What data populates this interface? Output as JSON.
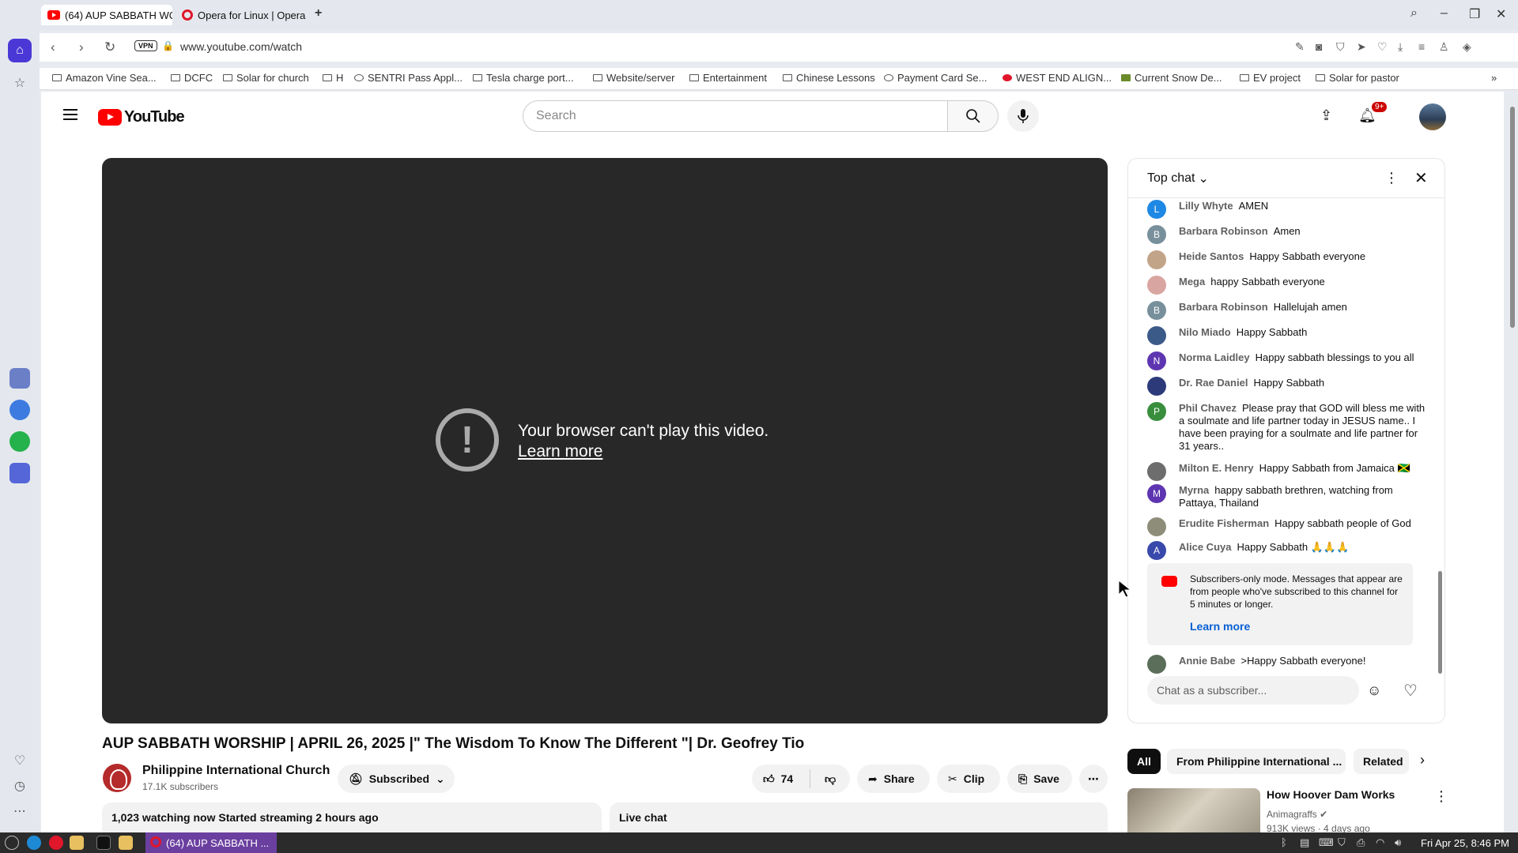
{
  "browser": {
    "tabs": [
      {
        "label": "(64) AUP SABBATH WO",
        "active": true
      },
      {
        "label": "Opera for Linux | Opera",
        "active": false
      }
    ],
    "url": "www.youtube.com/watch",
    "vpn_label": "VPN",
    "bookmarks": [
      "Amazon Vine Sea...",
      "DCFC",
      "Solar for church",
      "H",
      "SENTRI Pass Appl...",
      "Tesla charge port...",
      "Website/server",
      "Entertainment",
      "Chinese Lessons",
      "Payment Card Se...",
      "WEST END ALIGN...",
      "Current Snow De...",
      "EV project",
      "Solar for pastor"
    ]
  },
  "youtube": {
    "logo_text": "YouTube",
    "search_placeholder": "Search",
    "notification_badge": "9+",
    "player": {
      "error_title": "Your browser can't play this video.",
      "error_link": "Learn more"
    },
    "video": {
      "title": "AUP SABBATH WORSHIP | APRIL 26, 2025 |\" The Wisdom To Know The Different \"| Dr. Geofrey Tio",
      "channel": "Philippine International Church",
      "subscribers": "17.1K subscribers",
      "subscribed_label": "Subscribed",
      "likes": "74",
      "share_label": "Share",
      "clip_label": "Clip",
      "save_label": "Save",
      "watching": "1,023 watching now  Started streaming 2 hours ago",
      "live_chat_label": "Live chat"
    },
    "chat": {
      "header": "Top chat",
      "messages": [
        {
          "author": "Lilly Whyte",
          "text": "AMEN",
          "initial": "L",
          "color": "#1e88e5"
        },
        {
          "author": "Barbara Robinson",
          "text": "Amen",
          "initial": "B",
          "color": "#78909c"
        },
        {
          "author": "Heide Santos",
          "text": "Happy Sabbath everyone",
          "initial": "",
          "color": "#c2a488"
        },
        {
          "author": "Mega",
          "text": "happy Sabbath everyone",
          "initial": "",
          "color": "#d9a5a0"
        },
        {
          "author": "Barbara Robinson",
          "text": "Hallelujah amen",
          "initial": "B",
          "color": "#78909c"
        },
        {
          "author": "Nilo Miado",
          "text": "Happy Sabbath",
          "initial": "",
          "color": "#3c5a88"
        },
        {
          "author": "Norma Laidley",
          "text": "Happy sabbath blessings to you all",
          "initial": "N",
          "color": "#5e35b1"
        },
        {
          "author": "Dr. Rae Daniel",
          "text": "Happy Sabbath",
          "initial": "",
          "color": "#2d3a7a"
        },
        {
          "author": "Phil Chavez",
          "text": "Please pray that GOD will bless me with a soulmate and life partner today in JESUS name.. I have been praying for a soulmate and life partner for 31 years..",
          "initial": "P",
          "color": "#388e3c"
        },
        {
          "author": "Milton E. Henry",
          "text": "Happy Sabbath from Jamaica 🇯🇲",
          "initial": "",
          "color": "#6d6d6d"
        },
        {
          "author": "Myrna",
          "text": "happy sabbath brethren, watching from Pattaya, Thailand",
          "initial": "M",
          "color": "#5e35b1"
        },
        {
          "author": "Erudite Fisherman",
          "text": "Happy sabbath people of God",
          "initial": "",
          "color": "#8d8d7a"
        },
        {
          "author": "Alice Cuya",
          "text": "Happy Sabbath 🙏🙏🙏",
          "initial": "A",
          "color": "#3949ab"
        },
        {
          "author": "Annie Babe",
          "text": ">Happy Sabbath everyone!",
          "initial": "",
          "color": "#5a6e5a"
        }
      ],
      "subscriber_notice": "Subscribers-only mode. Messages that appear are from people who've subscribed to this channel for 5 minutes or longer.",
      "subscriber_notice_link": "Learn more",
      "input_placeholder": "Chat as a subscriber..."
    },
    "chips": [
      "All",
      "From Philippine International ...",
      "Related"
    ],
    "recommendation": {
      "title": "How Hoover Dam Works",
      "channel": "Animagraffs",
      "meta": "913K views · 4 days ago"
    }
  },
  "taskbar": {
    "task_label": "(64) AUP SABBATH ...",
    "clock": "Fri Apr 25,  8:46 PM"
  }
}
